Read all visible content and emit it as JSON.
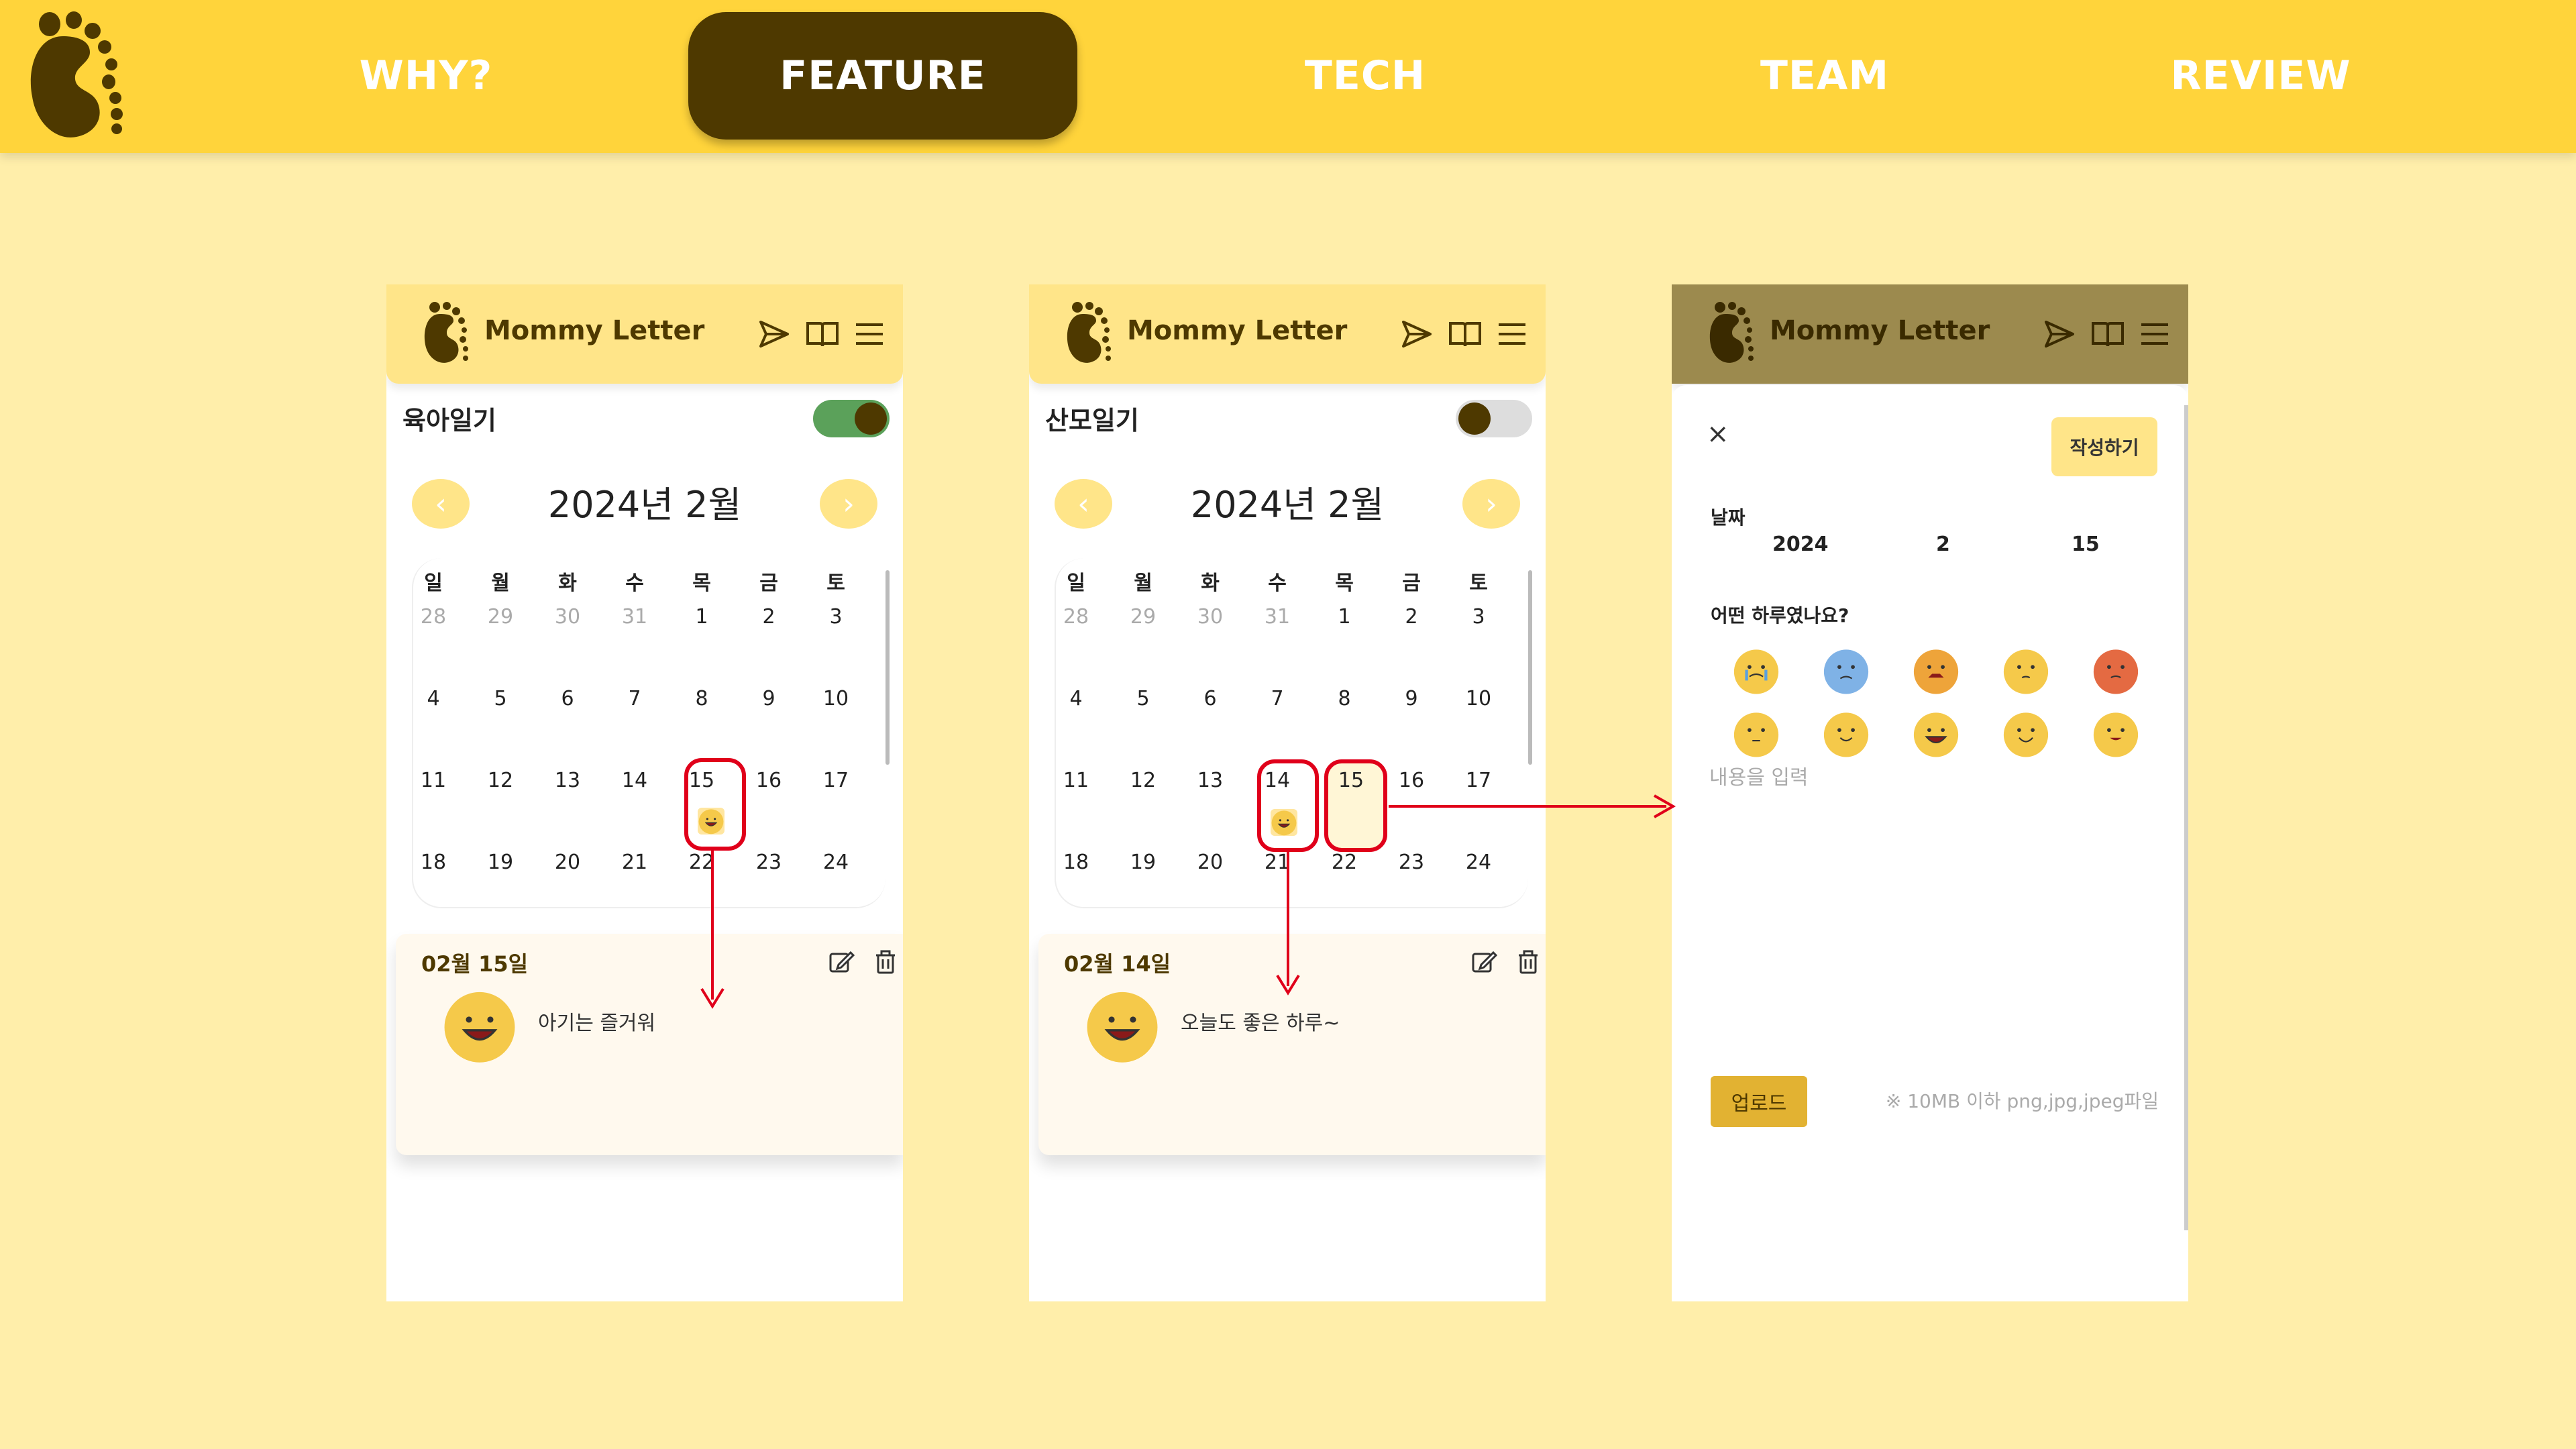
{
  "nav": {
    "items": [
      {
        "label": "WHY?"
      },
      {
        "label": "FEATURE"
      },
      {
        "label": "TECH"
      },
      {
        "label": "TEAM"
      },
      {
        "label": "REVIEW"
      }
    ],
    "active": "FEATURE"
  },
  "colors": {
    "brand_yellow": "#FFD43B",
    "brand_brown": "#4E3900",
    "page_bg": "#FFEEAA",
    "highlight_red": "#E0001A",
    "toggle_on": "#5BA15A"
  },
  "app": {
    "title": "Mommy Letter"
  },
  "screens": [
    {
      "toggle_label": "육아일기",
      "toggle_on": true,
      "month_title": "2024년 2월",
      "prev": "‹",
      "next": "›",
      "entry": {
        "date": "02월 15일",
        "text": "아기는 즐거워"
      }
    },
    {
      "toggle_label": "산모일기",
      "toggle_on": false,
      "month_title": "2024년 2월",
      "prev": "‹",
      "next": "›",
      "entry": {
        "date": "02월 14일",
        "text": "오늘도 좋은 하루~"
      }
    }
  ],
  "calendar": {
    "weekdays": [
      "일",
      "월",
      "화",
      "수",
      "목",
      "금",
      "토"
    ],
    "weeks": [
      [
        "28",
        "29",
        "30",
        "31",
        "1",
        "2",
        "3"
      ],
      [
        "4",
        "5",
        "6",
        "7",
        "8",
        "9",
        "10"
      ],
      [
        "11",
        "12",
        "13",
        "14",
        "15",
        "16",
        "17"
      ],
      [
        "18",
        "19",
        "20",
        "21",
        "22",
        "23",
        "24"
      ]
    ]
  },
  "form": {
    "close": "×",
    "write_button": "작성하기",
    "date_label": "날짜",
    "year": "2024",
    "month": "2",
    "day": "15",
    "mood_question": "어떤 하루였나요?",
    "content_placeholder": "내용을 입력",
    "upload_button": "업로드",
    "upload_hint": "※ 10MB 이하 png,jpg,jpeg파일"
  }
}
